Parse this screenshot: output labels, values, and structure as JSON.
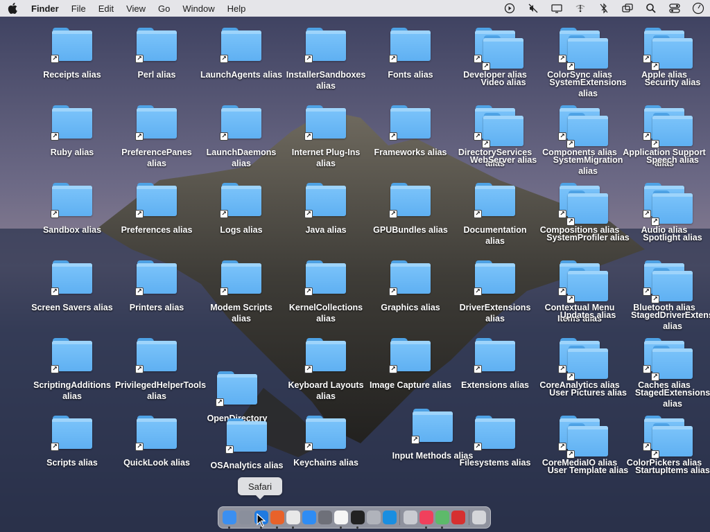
{
  "menubar": {
    "app_name": "Finder",
    "menus": [
      "File",
      "Edit",
      "View",
      "Go",
      "Window",
      "Help"
    ],
    "status_icons": [
      "play-circle-icon",
      "speaker-muted-icon",
      "display-icon",
      "wifi-off-icon",
      "bluetooth-off-icon",
      "screen-mirroring-icon",
      "search-icon",
      "control-center-icon",
      "clock-icon"
    ]
  },
  "desktop": {
    "icons": [
      {
        "label": "Receipts alias"
      },
      {
        "label": "Perl alias"
      },
      {
        "label": "LaunchAgents alias"
      },
      {
        "label": "InstallerSandboxes alias"
      },
      {
        "label": "Fonts alias"
      },
      {
        "label": "Developer alias"
      },
      {
        "label": "Video alias"
      },
      {
        "label": "ColorSync alias"
      },
      {
        "label": "SystemExtensions alias"
      },
      {
        "label": "Apple alias"
      },
      {
        "label": "Security alias"
      },
      {
        "label": "Ruby alias"
      },
      {
        "label": "PreferencePanes alias"
      },
      {
        "label": "LaunchDaemons alias"
      },
      {
        "label": "Internet Plug-Ins alias"
      },
      {
        "label": "Frameworks alias"
      },
      {
        "label": "DirectoryServices alias"
      },
      {
        "label": "WebServer alias"
      },
      {
        "label": "Components alias"
      },
      {
        "label": "SystemMigration alias"
      },
      {
        "label": "Application Support alias"
      },
      {
        "label": "Speech alias"
      },
      {
        "label": "Sandbox alias"
      },
      {
        "label": "Preferences alias"
      },
      {
        "label": "Logs alias"
      },
      {
        "label": "Java alias"
      },
      {
        "label": "GPUBundles alias"
      },
      {
        "label": "Documentation alias"
      },
      {
        "label": "Compositions alias"
      },
      {
        "label": "SystemProfiler alias"
      },
      {
        "label": "Audio alias"
      },
      {
        "label": "Spotlight alias"
      },
      {
        "label": "Screen Savers alias"
      },
      {
        "label": "Printers alias"
      },
      {
        "label": "Modem Scripts alias"
      },
      {
        "label": "KernelCollections alias"
      },
      {
        "label": "Graphics alias"
      },
      {
        "label": "DriverExtensions alias"
      },
      {
        "label": "Contextual Menu Items alias"
      },
      {
        "label": "Updates alias"
      },
      {
        "label": "Bluetooth alias"
      },
      {
        "label": "StagedDriverExtensions alias"
      },
      {
        "label": "ScriptingAdditions alias"
      },
      {
        "label": "PrivilegedHelperTools alias"
      },
      {
        "label": "OpenDirectory"
      },
      {
        "label": "Keyboard Layouts alias"
      },
      {
        "label": "Image Capture alias"
      },
      {
        "label": "Extensions alias"
      },
      {
        "label": "CoreAnalytics alias"
      },
      {
        "label": "User Pictures alias"
      },
      {
        "label": "Caches alias"
      },
      {
        "label": "StagedExtensions alias"
      },
      {
        "label": "Scripts alias"
      },
      {
        "label": "QuickLook alias"
      },
      {
        "label": "OSAnalytics alias"
      },
      {
        "label": "Keychains alias"
      },
      {
        "label": "Input Methods alias"
      },
      {
        "label": "Filesystems alias"
      },
      {
        "label": "CoreMediaIO alias"
      },
      {
        "label": "User Template alias"
      },
      {
        "label": "ColorPickers alias"
      },
      {
        "label": "StartupItems alias"
      }
    ]
  },
  "dock": {
    "tooltip": "Safari",
    "apps": [
      {
        "name": "finder-icon",
        "color": "#3b8ff0"
      },
      {
        "name": "launchpad-icon",
        "color": "#8a8f9c"
      },
      {
        "name": "safari-icon",
        "color": "#1f7ae0"
      },
      {
        "name": "firefox-icon",
        "color": "#e8622a"
      },
      {
        "name": "chrome-icon",
        "color": "#e8e8e8"
      },
      {
        "name": "app-store-icon",
        "color": "#2f8cf3"
      },
      {
        "name": "system-preferences-icon",
        "color": "#6e7079"
      },
      {
        "name": "textedit-icon",
        "color": "#f5f5f5"
      },
      {
        "name": "terminal-icon",
        "color": "#222222"
      },
      {
        "name": "script-editor-icon",
        "color": "#b0b3bb"
      },
      {
        "name": "vscode-icon",
        "color": "#1a8ee0"
      },
      {
        "name": "simulator-icon",
        "color": "#c9cbd1"
      },
      {
        "name": "music-icon",
        "color": "#f0405c"
      },
      {
        "name": "maps-icon",
        "color": "#5dba6a"
      },
      {
        "name": "photo-booth-icon",
        "color": "#d63030"
      },
      {
        "name": "trash-icon",
        "color": "#d5d6da"
      }
    ]
  }
}
